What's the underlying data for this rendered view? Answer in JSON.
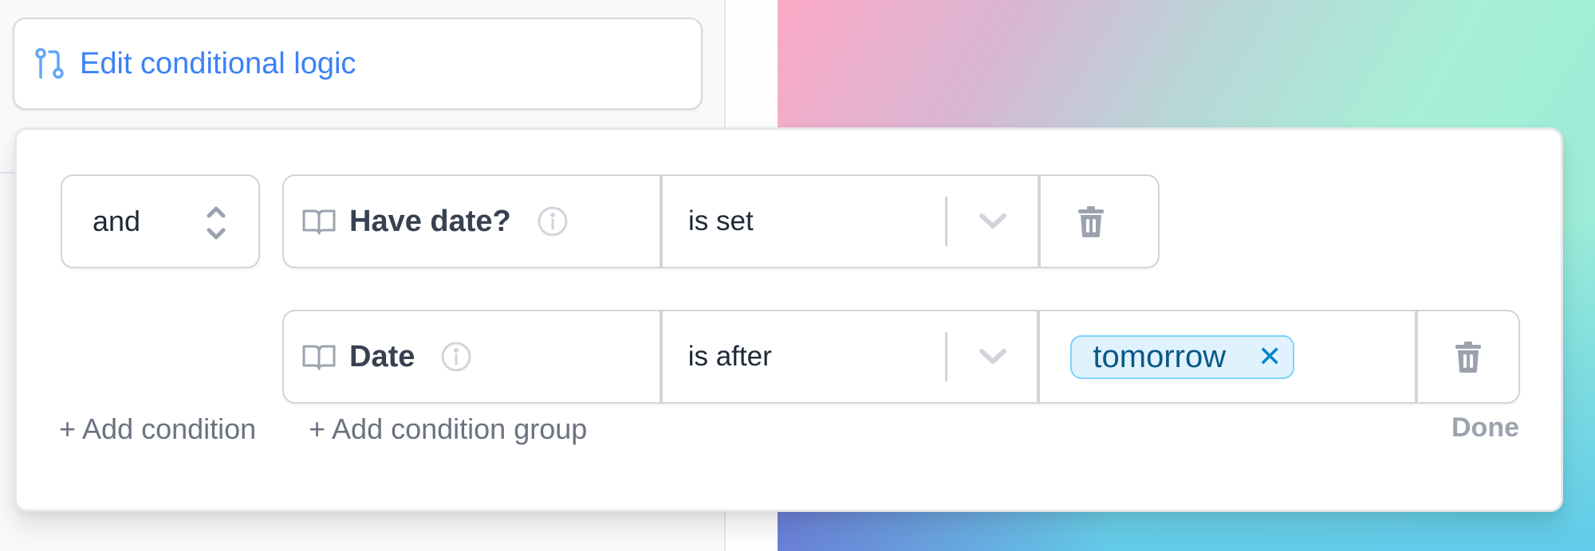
{
  "edit_button": {
    "icon": "git-branch-icon",
    "label": "Edit conditional logic",
    "color": "#3b82f6"
  },
  "logic_panel": {
    "combinator": {
      "value": "and",
      "icon": "chevron-up-down-icon"
    },
    "conditions": [
      {
        "field_icon": "book-open-icon",
        "field": "Have date?",
        "info_icon": "info-circle-icon",
        "operator": "is set",
        "operator_icon": "chevron-down-icon",
        "values": [],
        "delete_icon": "trash-icon"
      },
      {
        "field_icon": "book-open-icon",
        "field": "Date",
        "info_icon": "info-circle-icon",
        "operator": "is after",
        "operator_icon": "chevron-down-icon",
        "values": [
          {
            "label": "tomorrow",
            "remove_icon": "close-icon",
            "remove_glyph": "✕"
          }
        ],
        "delete_icon": "trash-icon"
      }
    ],
    "add_condition_label": "+ Add condition",
    "add_condition_group_label": "+ Add condition group",
    "done_label": "Done"
  }
}
